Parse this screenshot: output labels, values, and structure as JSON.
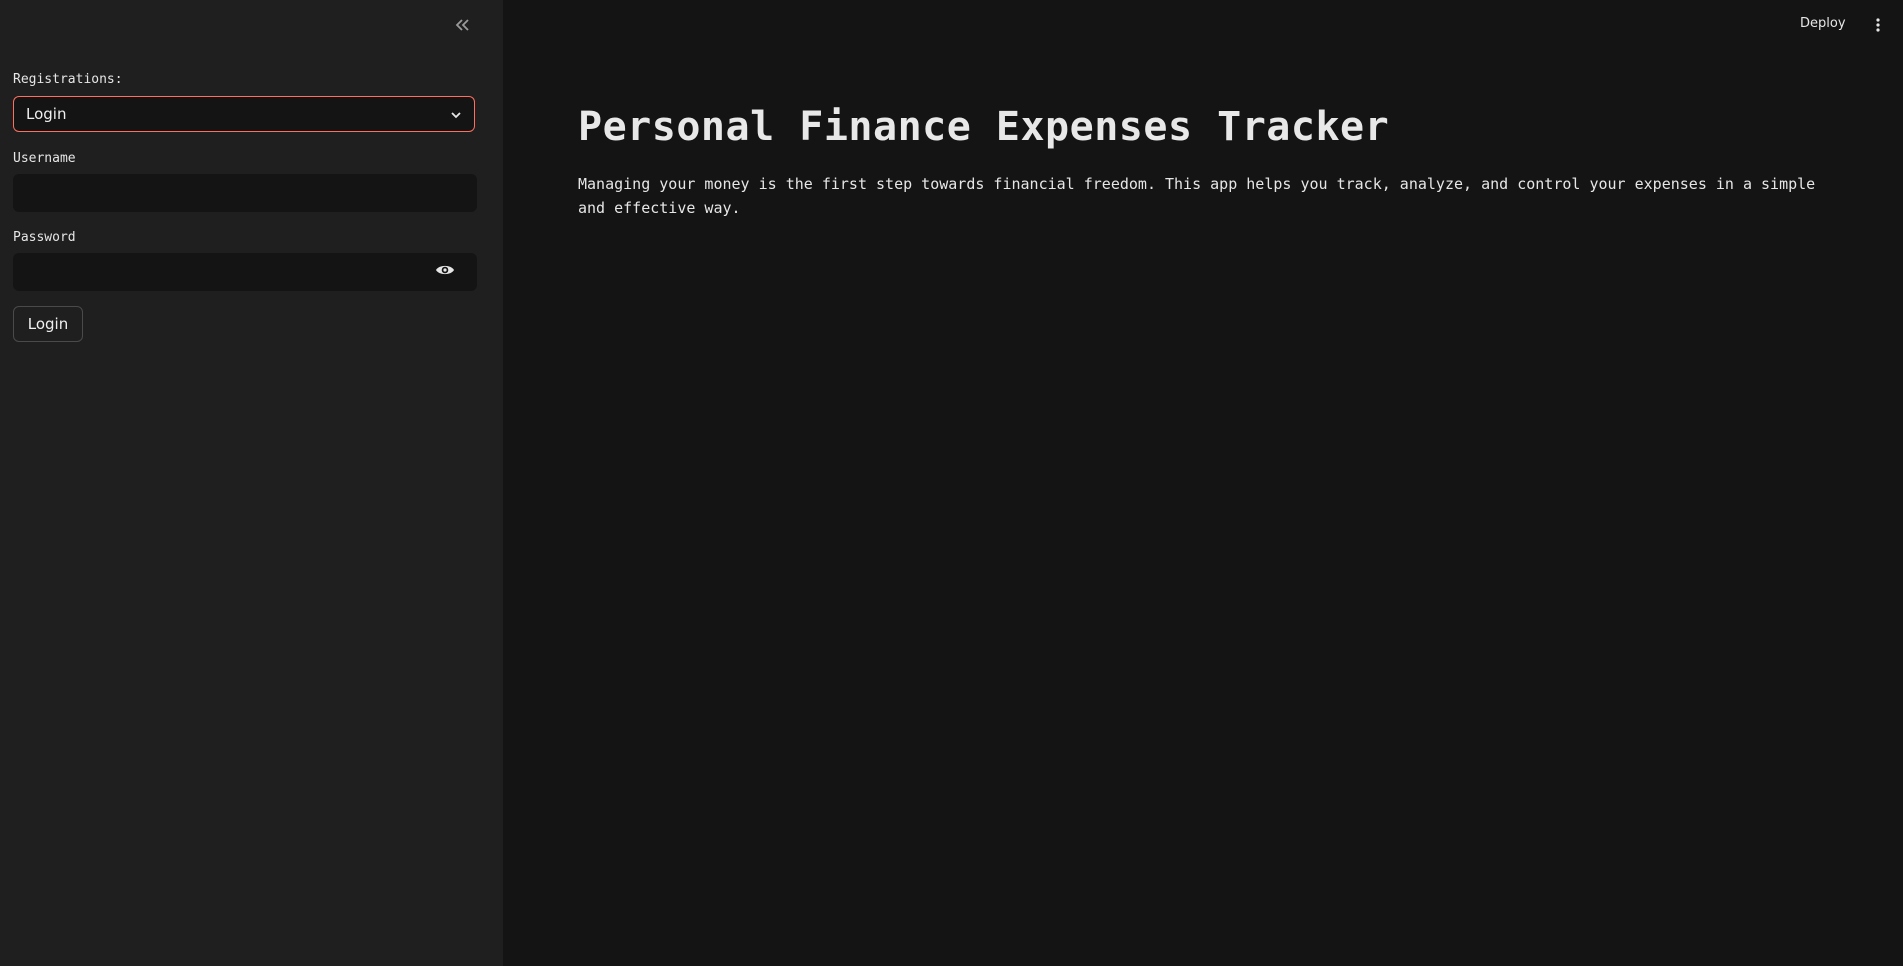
{
  "sidebar": {
    "collapse_icon": "double-chevron-left-icon",
    "registrations_label": "Registrations:",
    "registrations_select": {
      "value": "Login",
      "icon": "chevron-down-icon"
    },
    "username_label": "Username",
    "username_value": "",
    "password_label": "Password",
    "password_value": "",
    "password_toggle_icon": "eye-icon",
    "login_button": "Login"
  },
  "topbar": {
    "deploy_label": "Deploy",
    "menu_icon": "vertical-ellipsis-icon"
  },
  "main": {
    "title": "Personal Finance Expenses Tracker",
    "description": "Managing your money is the first step towards financial freedom. This app helps you track, analyze, and control your expenses in a simple and effective way."
  },
  "colors": {
    "background": "#141414",
    "sidebar_background": "#1f1f1f",
    "accent_border": "#ff6f5e",
    "text": "#e6e6e6"
  }
}
